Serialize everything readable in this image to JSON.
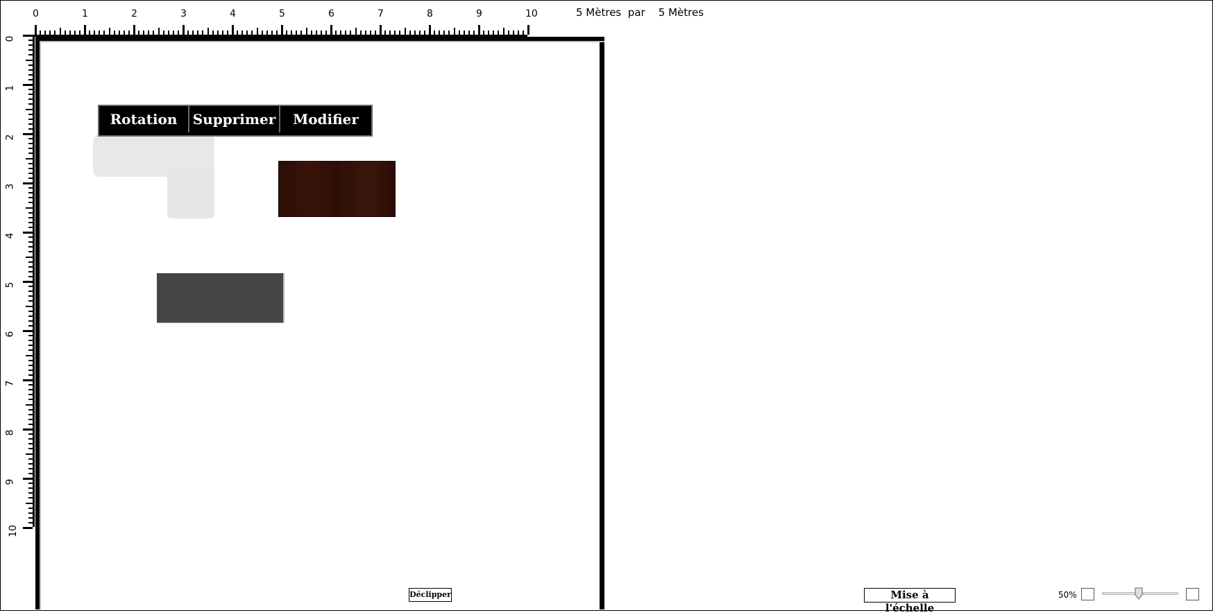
{
  "ruler": {
    "top_labels": [
      "0",
      "1",
      "2",
      "3",
      "4",
      "5",
      "6",
      "7",
      "8",
      "9",
      "10"
    ],
    "left_labels": [
      "0",
      "1",
      "2",
      "3",
      "4",
      "5",
      "6",
      "7",
      "8",
      "9",
      "10"
    ]
  },
  "dimensions": {
    "width_value": "5 Mètres",
    "separator": "par",
    "height_value": "5 Mètres"
  },
  "context_toolbar": {
    "rotate_label": "Rotation",
    "delete_label": "Supprimer",
    "edit_label": "Modifier"
  },
  "furniture": [
    {
      "name": "l-shaped-desk",
      "color": "#e8e8e8"
    },
    {
      "name": "wood-desk",
      "color": "#2e0f07"
    },
    {
      "name": "dark-desk",
      "color": "#454545"
    }
  ],
  "buttons": {
    "declip_label": "Déclipper",
    "scale_label": "Mise à l'échelle"
  },
  "zoom": {
    "label": "50%",
    "level": 0.5
  }
}
